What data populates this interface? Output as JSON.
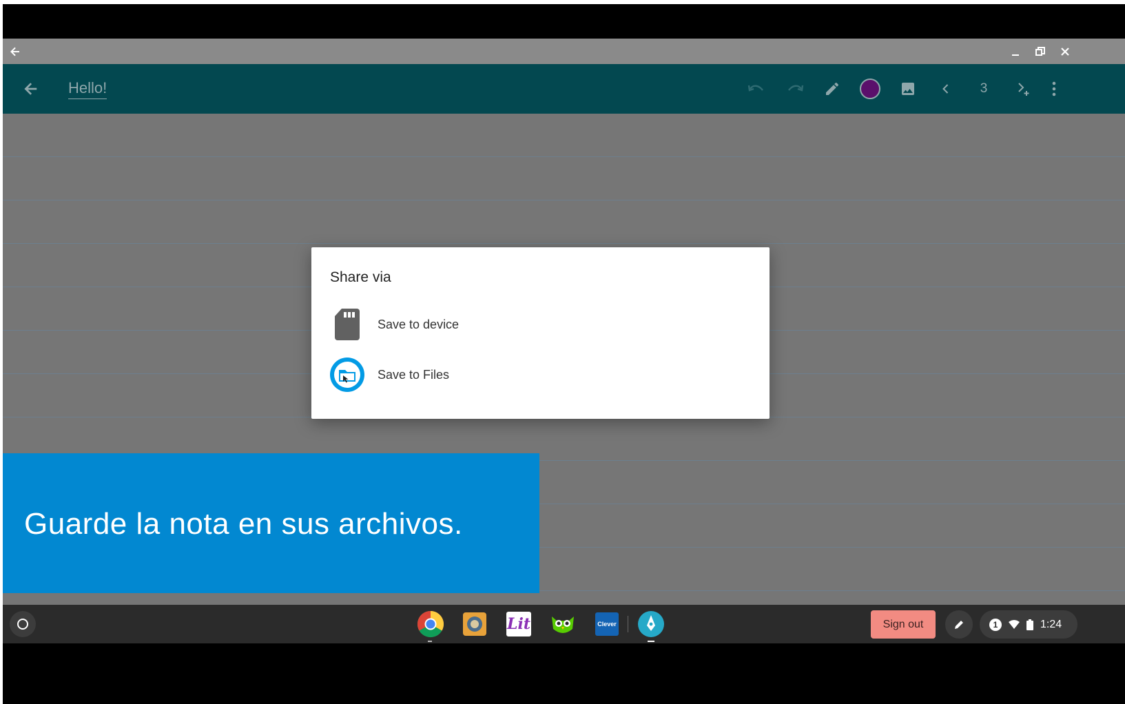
{
  "app": {
    "note_title": "Hello!",
    "page_number": "3"
  },
  "colors": {
    "toolbar": "#034850",
    "pen_color": "#5a0f6b",
    "caption_bg": "#0288d1",
    "signout_bg": "#f28b82"
  },
  "dialog": {
    "title": "Share via",
    "options": [
      {
        "label": "Save to device",
        "icon": "sd-card-icon"
      },
      {
        "label": "Save to Files",
        "icon": "files-folder-icon"
      }
    ]
  },
  "caption": {
    "text": "Guarde la nota en sus archivos."
  },
  "shelf": {
    "apps": [
      "chrome-icon",
      "app-2-icon",
      "lit-app-icon",
      "owl-app-icon",
      "clever-icon",
      "pen-app-icon"
    ],
    "clever_label": "Clever",
    "lit_label": "Lit",
    "signout_label": "Sign out",
    "notification_count": "1",
    "time": "1:24"
  }
}
